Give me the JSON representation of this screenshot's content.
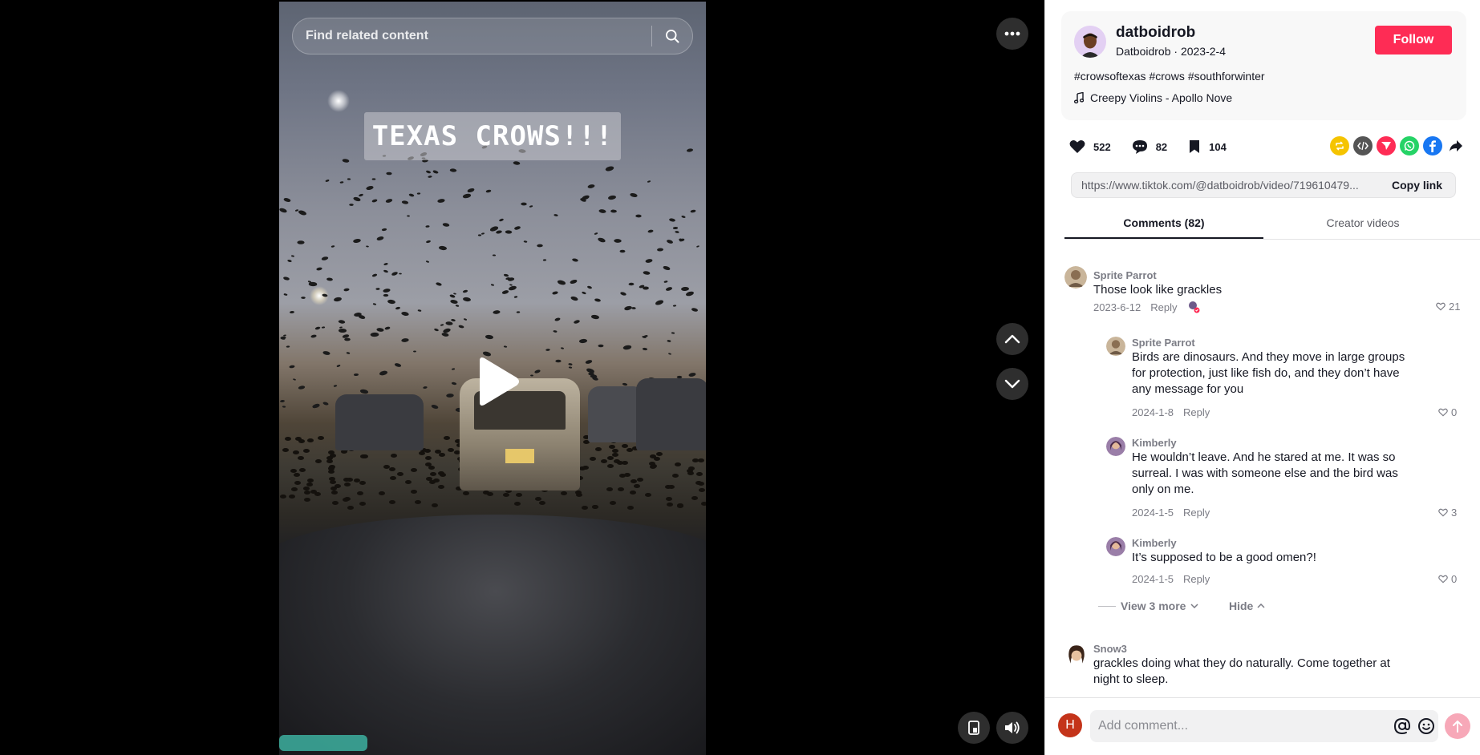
{
  "search": {
    "placeholder": "Find related content"
  },
  "video": {
    "overlay_text": "TEXAS CROWS!!!"
  },
  "author": {
    "username": "datboidrob",
    "display_name": "Datboidrob",
    "date": "2023-2-4",
    "separator": " · ",
    "follow_label": "Follow"
  },
  "hashtags": [
    "#crowsoftexas",
    "#crows",
    "#southforwinter"
  ],
  "music": {
    "title": "Creepy Violins - Apollo Nove"
  },
  "stats": {
    "likes": "522",
    "comments": "82",
    "saves": "104"
  },
  "share": {
    "icons": [
      "repost-icon",
      "embed-icon",
      "send-icon",
      "whatsapp-icon",
      "facebook-icon",
      "share-arrow-icon"
    ]
  },
  "link": {
    "url": "https://www.tiktok.com/@datboidrob/video/719610479...",
    "copy_label": "Copy link"
  },
  "tabs": [
    {
      "label": "Comments (82)"
    },
    {
      "label": "Creator videos"
    }
  ],
  "comments": [
    {
      "name": "Sprite Parrot",
      "text": "Those look like grackles",
      "date": "2023-6-12",
      "reply": "Reply",
      "likes": "21"
    },
    {
      "name": "Sprite Parrot",
      "text": "Birds are dinosaurs. And they move in large groups for protection, just like fish do, and they don’t have any message for you",
      "date": "2024-1-8",
      "reply": "Reply",
      "likes": "0"
    },
    {
      "name": "Kimberly",
      "text": "He wouldn’t leave. And he stared at me. It was so surreal. I was with someone else and the bird was only on me.",
      "date": "2024-1-5",
      "reply": "Reply",
      "likes": "3"
    },
    {
      "name": "Kimberly",
      "text": "It’s supposed to be a good omen?!",
      "date": "2024-1-5",
      "reply": "Reply",
      "likes": "0"
    },
    {
      "name": "Snow3",
      "text": "grackles doing what they do naturally. Come together at night to sleep.",
      "date": "",
      "reply": "",
      "likes": ""
    }
  ],
  "replies_controls": {
    "view_more": "View 3 more",
    "hide": "Hide"
  },
  "comment_box": {
    "placeholder": "Add comment...",
    "user_initial": "H"
  },
  "colors": {
    "accent": "#fe2c55",
    "repost": "#f5c400",
    "embed": "#555555",
    "send": "#fe2c55",
    "whatsapp": "#25d366",
    "facebook": "#1877f2"
  }
}
